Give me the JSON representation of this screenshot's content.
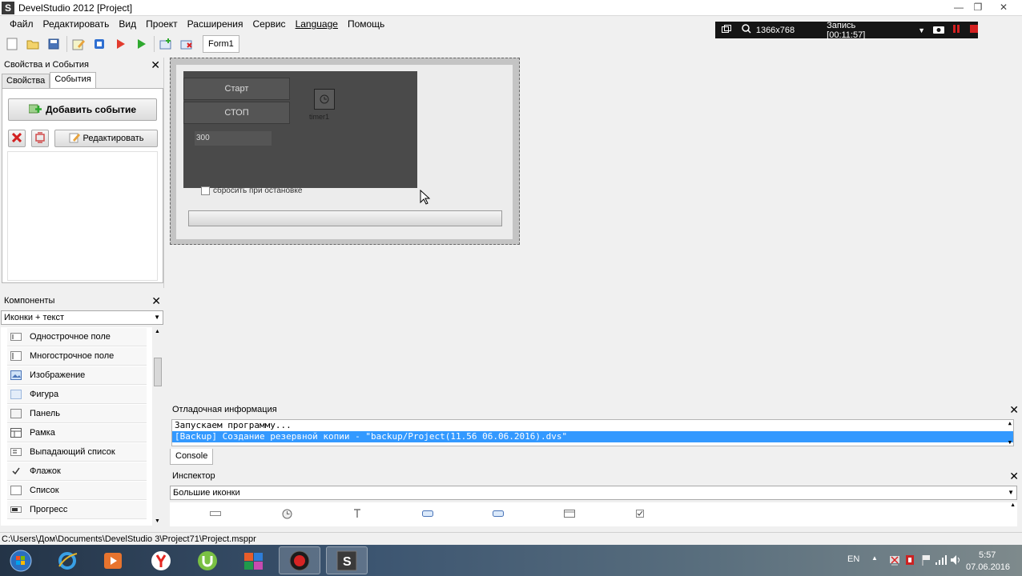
{
  "window": {
    "title": "DevelStudio 2012 [Project]",
    "app_icon_glyph": "S",
    "minimize_glyph": "—",
    "maximize_glyph": "❐",
    "close_glyph": "✕"
  },
  "menu": [
    "Файл",
    "Редактировать",
    "Вид",
    "Проект",
    "Расширения",
    "Сервис",
    "Language",
    "Помощь"
  ],
  "toolbar": {
    "form_tab_label": "Form1",
    "icons": [
      "new-file-icon",
      "open-folder-icon",
      "save-icon",
      "edit-form-icon",
      "stop-square-icon",
      "run-red-icon",
      "run-green-icon",
      "add-form-icon",
      "delete-form-icon"
    ]
  },
  "recorder": {
    "resolution": "1366x768",
    "recording_label": "Запись [00:11:57]"
  },
  "props_panel": {
    "title": "Свойства и События",
    "close_glyph": "✕",
    "tabs": [
      "Свойства",
      "События"
    ],
    "active_tab": 1,
    "add_event_label": "Добавить событие",
    "edit_label": "Редактировать"
  },
  "components_panel": {
    "title": "Компоненты",
    "close_glyph": "✕",
    "view_mode": "Иконки + текст",
    "items": [
      {
        "label": "Однострочное поле",
        "icon": "edit-field-icon"
      },
      {
        "label": "Многострочное поле",
        "icon": "memo-icon"
      },
      {
        "label": "Изображение",
        "icon": "image-icon"
      },
      {
        "label": "Фигура",
        "icon": "shape-icon"
      },
      {
        "label": "Панель",
        "icon": "panel-icon"
      },
      {
        "label": "Рамка",
        "icon": "frame-icon"
      },
      {
        "label": "Выпадающий список",
        "icon": "combobox-icon"
      },
      {
        "label": "Флажок",
        "icon": "checkbox-icon"
      },
      {
        "label": "Список",
        "icon": "listbox-icon"
      },
      {
        "label": "Прогресс",
        "icon": "progress-icon"
      }
    ]
  },
  "designer": {
    "start_button": "Старт",
    "stop_button": "СТОП",
    "interval_value": "300",
    "timer_label": "timer1",
    "reset_checkbox_label": "сбросить при остановке"
  },
  "debug_panel": {
    "title": "Отладочная информация",
    "close_glyph": "✕",
    "lines": [
      "Запускаем программу...",
      "[Backup] Создание резервной копии - \"backup/Project(11.56 06.06.2016).dvs\""
    ],
    "selected_line": 1,
    "console_tab": "Console"
  },
  "inspector_panel": {
    "title": "Инспектор",
    "close_glyph": "✕",
    "view_mode": "Большие иконки"
  },
  "status_bar": {
    "path": "C:\\Users\\Дом\\Documents\\DevelStudio 3\\Project71\\Project.msppr"
  },
  "taskbar": {
    "language": "EN",
    "time": "5:57",
    "date": "07.06.2016",
    "apps": [
      "start-orb-icon",
      "ie-icon",
      "media-player-icon",
      "yandex-icon",
      "utorrent-icon",
      "office-icon",
      "recorder-icon",
      "develstudio-icon"
    ]
  },
  "colors": {
    "selection": "#3399ff",
    "dark_panel": "#4a4a4a",
    "recorder_bar": "#151515"
  }
}
